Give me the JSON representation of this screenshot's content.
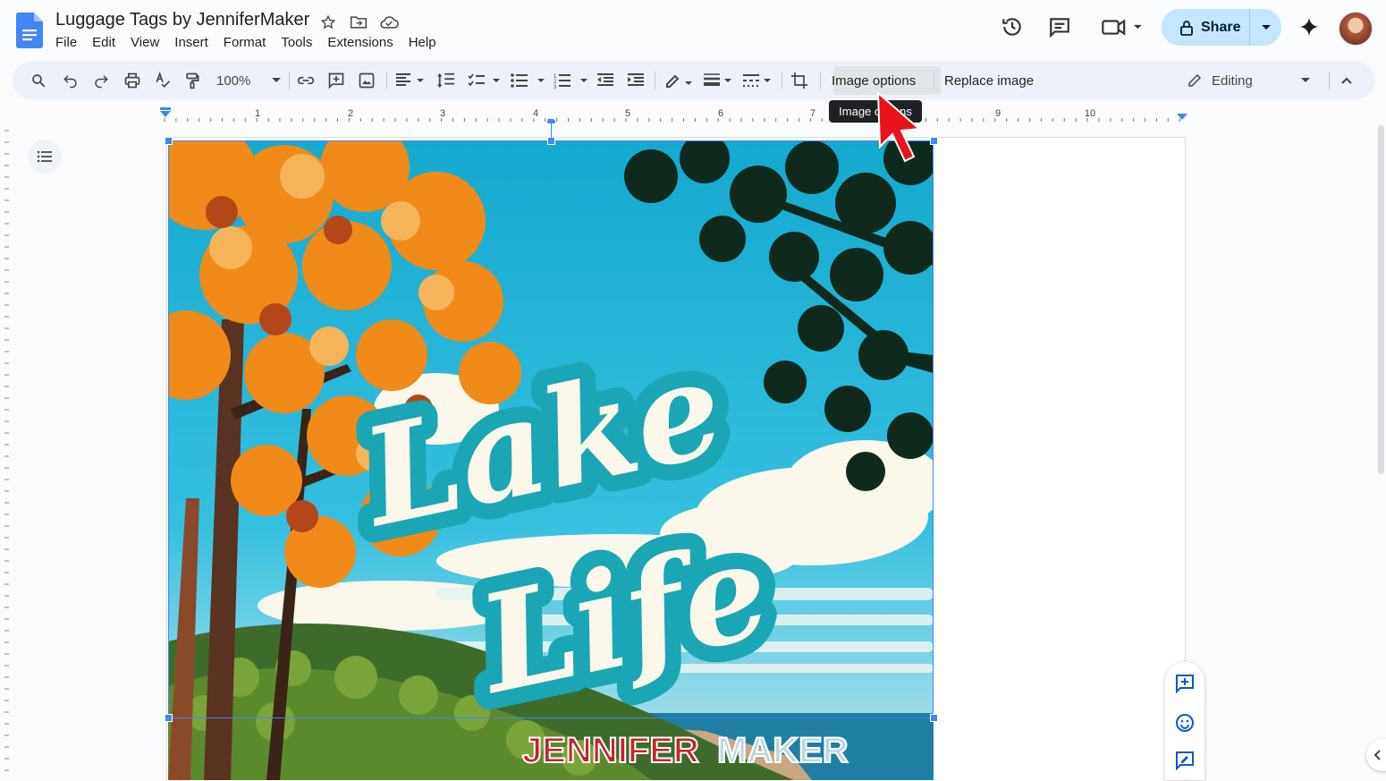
{
  "document": {
    "title": "Luggage Tags by JenniferMaker"
  },
  "menu": [
    "File",
    "Edit",
    "View",
    "Insert",
    "Format",
    "Tools",
    "Extensions",
    "Help"
  ],
  "header": {
    "share_label": "Share"
  },
  "toolbar": {
    "zoom": "100%",
    "image_options_label": "Image options",
    "replace_image_label": "Replace image",
    "mode_label": "Editing"
  },
  "tooltip": {
    "text": "Image options"
  },
  "ruler": {
    "marks": [
      "1",
      "2",
      "3",
      "4",
      "5",
      "6",
      "7",
      "9",
      "10"
    ]
  },
  "image": {
    "headline_line1": "Lake",
    "headline_line2": "Life",
    "watermark_part1": "JENNIFER",
    "watermark_part2": "MAKER"
  },
  "colors": {
    "accent": "#0b57d0",
    "share_bg": "#c2e7ff",
    "sky": "#29b8d6",
    "teal": "#1aa6b4",
    "cursor": "#e8141a"
  }
}
